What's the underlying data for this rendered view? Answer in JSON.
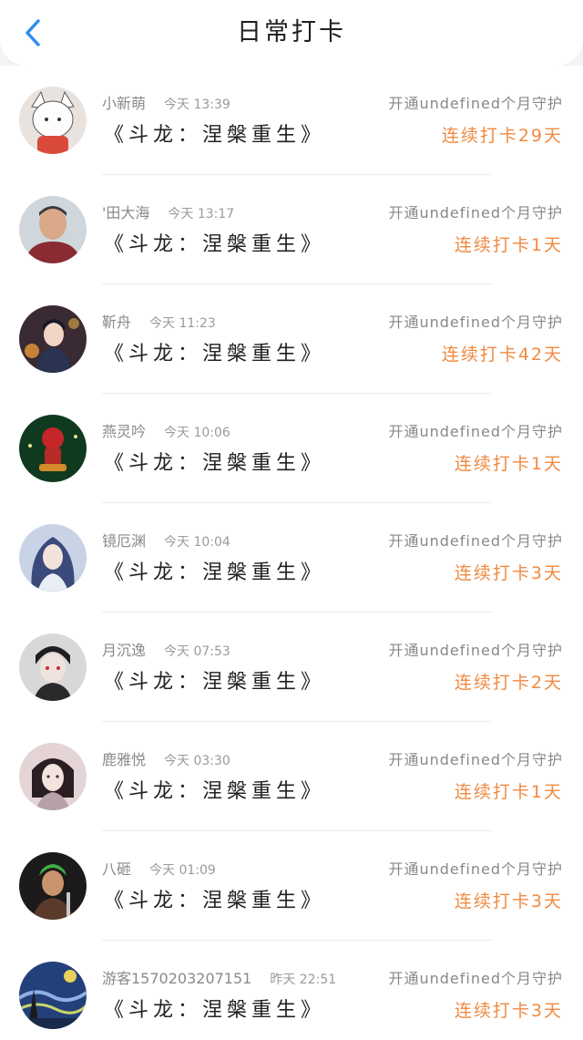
{
  "header": {
    "title": "日常打卡",
    "back_icon": "chevron-left-icon"
  },
  "colors": {
    "accent_blue": "#2f8ef0",
    "streak_orange": "#f08a42"
  },
  "records": [
    {
      "name": "小新萌",
      "time": "今天 13:39",
      "book": "《斗龙：涅槃重生》",
      "guard": "开通undefined个月守护",
      "streak": "连续打卡29天"
    },
    {
      "name": "'田大海",
      "time": "今天 13:17",
      "book": "《斗龙：涅槃重生》",
      "guard": "开通undefined个月守护",
      "streak": "连续打卡1天"
    },
    {
      "name": "靳舟",
      "time": "今天 11:23",
      "book": "《斗龙：涅槃重生》",
      "guard": "开通undefined个月守护",
      "streak": "连续打卡42天"
    },
    {
      "name": "燕灵吟",
      "time": "今天 10:06",
      "book": "《斗龙：涅槃重生》",
      "guard": "开通undefined个月守护",
      "streak": "连续打卡1天"
    },
    {
      "name": "镜厄渊",
      "time": "今天 10:04",
      "book": "《斗龙：涅槃重生》",
      "guard": "开通undefined个月守护",
      "streak": "连续打卡3天"
    },
    {
      "name": "月沉逸",
      "time": "今天 07:53",
      "book": "《斗龙：涅槃重生》",
      "guard": "开通undefined个月守护",
      "streak": "连续打卡2天"
    },
    {
      "name": "鹿雅悦",
      "time": "今天 03:30",
      "book": "《斗龙：涅槃重生》",
      "guard": "开通undefined个月守护",
      "streak": "连续打卡1天"
    },
    {
      "name": "八砸",
      "time": "今天 01:09",
      "book": "《斗龙：涅槃重生》",
      "guard": "开通undefined个月守护",
      "streak": "连续打卡3天"
    },
    {
      "name": "游客1570203207151",
      "time": "昨天 22:51",
      "book": "《斗龙：涅槃重生》",
      "guard": "开通undefined个月守护",
      "streak": "连续打卡3天"
    }
  ]
}
